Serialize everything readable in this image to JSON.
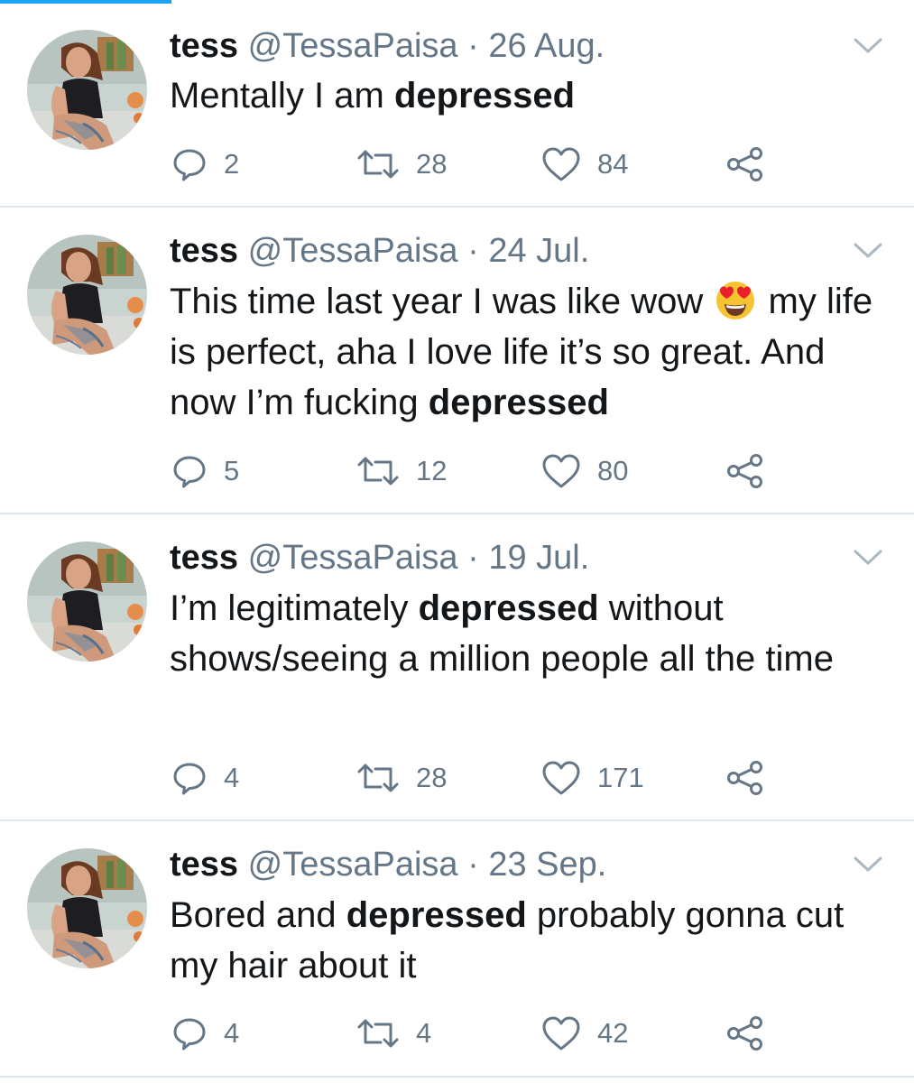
{
  "accent_color": "#1da1f2",
  "tweets": [
    {
      "name": "tess",
      "handle": "@TessaPaisa",
      "separator": "·",
      "date": "26 Aug.",
      "text": {
        "p1": "Mentally I am ",
        "bold": "depressed"
      },
      "replies": "2",
      "retweets": "28",
      "likes": "84"
    },
    {
      "name": "tess",
      "handle": "@TessaPaisa",
      "separator": "·",
      "date": "24 Jul.",
      "text": {
        "p1": "This time last year I was like wow ",
        "emoji": "smiling-face-with-heart-eyes",
        "p2": " my life is perfect, aha I love life it’s so great. And now I’m fucking ",
        "bold": "depressed"
      },
      "replies": "5",
      "retweets": "12",
      "likes": "80"
    },
    {
      "name": "tess",
      "handle": "@TessaPaisa",
      "separator": "·",
      "date": "19 Jul.",
      "text": {
        "p1": "I’m legitimately ",
        "bold": "depressed",
        "p2": " without shows/seeing a million people all the time"
      },
      "replies": "4",
      "retweets": "28",
      "likes": "171"
    },
    {
      "name": "tess",
      "handle": "@TessaPaisa",
      "separator": "·",
      "date": "23 Sep.",
      "text": {
        "p1": "Bored and ",
        "bold": "depressed",
        "p2": " probably gonna cut my hair about it"
      },
      "replies": "4",
      "retweets": "4",
      "likes": "42"
    }
  ]
}
